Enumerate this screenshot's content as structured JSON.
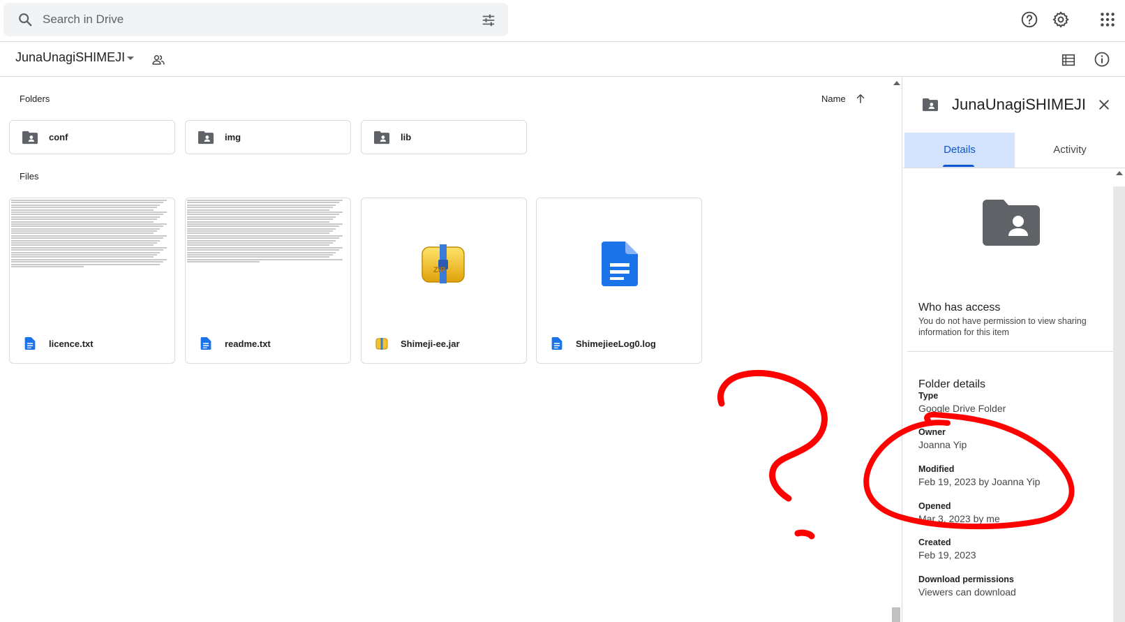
{
  "search": {
    "placeholder": "Search in Drive"
  },
  "header": {
    "breadcrumb": "JunaUnagiSHIMEJI"
  },
  "main": {
    "folders_label": "Folders",
    "files_label": "Files",
    "sort_label": "Name",
    "folders": [
      {
        "name": "conf"
      },
      {
        "name": "img"
      },
      {
        "name": "lib"
      }
    ],
    "files": [
      {
        "name": "licence.txt",
        "icon": "doc-icon"
      },
      {
        "name": "readme.txt",
        "icon": "doc-icon"
      },
      {
        "name": "Shimeji-ee.jar",
        "icon": "zip-icon"
      },
      {
        "name": "ShimejieeLog0.log",
        "icon": "doc-icon"
      }
    ]
  },
  "panel": {
    "title": "JunaUnagiSHIMEJI",
    "tabs": [
      "Details",
      "Activity"
    ],
    "who_has_access": "Who has access",
    "access_text": "You do not have permission to view sharing information for this item",
    "folder_details": "Folder details",
    "details": [
      {
        "label": "Type",
        "value": "Google Drive Folder"
      },
      {
        "label": "Owner",
        "value": "Joanna Yip"
      },
      {
        "label": "Modified",
        "value": "Feb 19, 2023 by Joanna Yip"
      },
      {
        "label": "Opened",
        "value": "Mar 3, 2023 by me"
      },
      {
        "label": "Created",
        "value": "Feb 19, 2023"
      },
      {
        "label": "Download permissions",
        "value": "Viewers can download"
      }
    ]
  },
  "colors": {
    "accent": "#0b57d0",
    "tab_active_bg": "#d3e3fd",
    "doc_blue": "#1a73e8",
    "annotation_red": "#ff0000"
  }
}
